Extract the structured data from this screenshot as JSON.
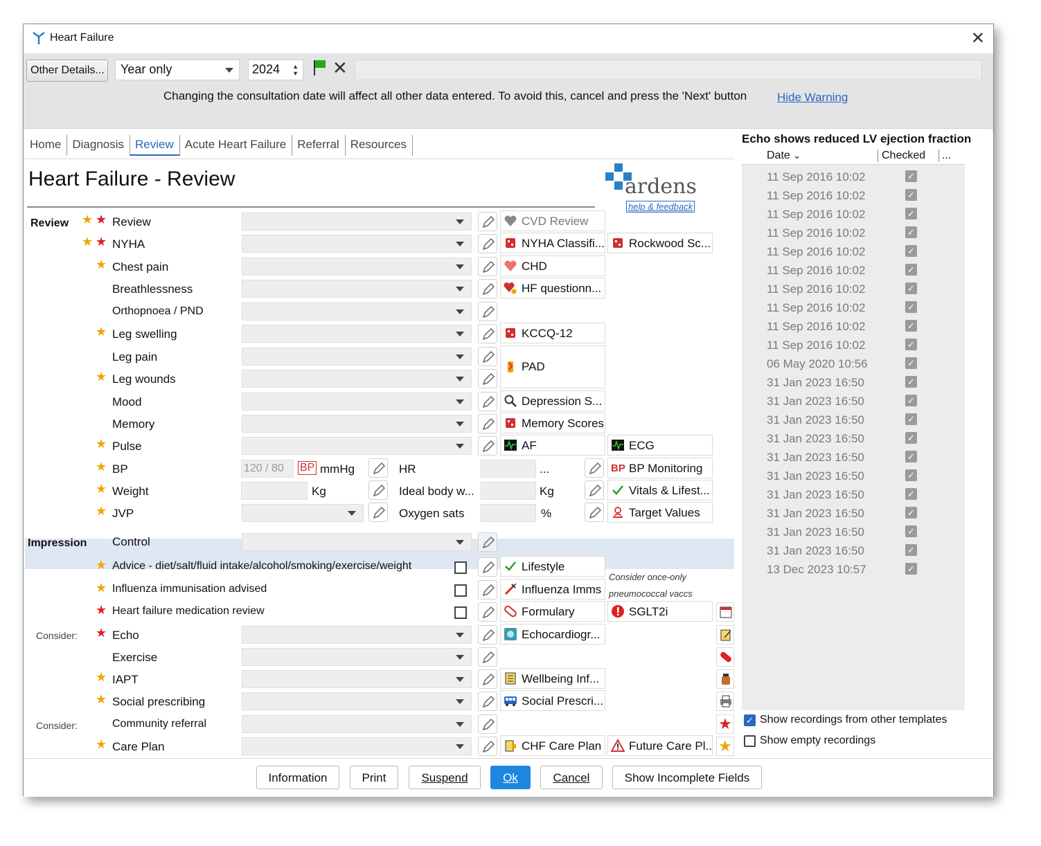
{
  "window": {
    "title": "Heart Failure"
  },
  "toolbar": {
    "other_details": "Other Details...",
    "year_mode": "Year only",
    "year": "2024",
    "warning": "Changing the consultation date will affect all other data entered. To avoid this, cancel and press the 'Next' button",
    "hide_warning": "Hide Warning"
  },
  "tabs": [
    "Home",
    "Diagnosis",
    "Review",
    "Acute Heart Failure",
    "Referral",
    "Resources"
  ],
  "page": {
    "title": "Heart Failure - Review",
    "logo_text": "ardens",
    "help_link": "help & feedback"
  },
  "sections": {
    "review": "Review",
    "impression": "Impression",
    "consider1": "Consider:",
    "consider2": "Consider:"
  },
  "rows": {
    "review": "Review",
    "nyha": "NYHA",
    "chest_pain": "Chest pain",
    "breathlessness": "Breathlessness",
    "orthopnoea": "Orthopnoea / PND",
    "leg_swelling": "Leg swelling",
    "leg_pain": "Leg pain",
    "leg_wounds": "Leg wounds",
    "mood": "Mood",
    "memory": "Memory",
    "pulse": "Pulse",
    "bp": "BP",
    "weight": "Weight",
    "jvp": "JVP",
    "control": "Control",
    "advice": "Advice - diet/salt/fluid intake/alcohol/smoking/exercise/weight",
    "influenza": "Influenza immunisation advised",
    "hf_med_review": "Heart failure medication review",
    "echo": "Echo",
    "exercise": "Exercise",
    "iapt": "IAPT",
    "social_prescribing": "Social prescribing",
    "community_referral": "Community referral",
    "care_plan": "Care Plan"
  },
  "fields": {
    "bp_placeholder": "120 / 80",
    "bp_badge": "BP",
    "mmhg": "mmHg",
    "kg": "Kg",
    "hr": "HR",
    "hr_unit": "...",
    "ideal_weight": "Ideal body w...",
    "ideal_kg": "Kg",
    "oxygen": "Oxygen sats",
    "percent": "%"
  },
  "links": {
    "cvd_review": "CVD Review",
    "nyha_class": "NYHA Classifi...",
    "rockwood": "Rockwood Sc...",
    "chd": "CHD",
    "hf_questionnaire": "HF questionn...",
    "kccq": "KCCQ-12",
    "pad": "PAD",
    "depression": "Depression S...",
    "memory_scores": "Memory Scores",
    "af": "AF",
    "ecg": "ECG",
    "bp_monitoring": "BP Monitoring",
    "vitals": "Vitals & Lifest...",
    "target_values": "Target Values",
    "lifestyle": "Lifestyle",
    "influenza_imms": "Influenza Imms",
    "formulary": "Formulary",
    "sglt2i": "SGLT2i",
    "echocardiogram": "Echocardiogr...",
    "wellbeing": "Wellbeing Inf...",
    "social_prescri": "Social Prescri...",
    "chf_care_plan": "CHF Care Plan",
    "future_care": "Future Care Pl..."
  },
  "notes": {
    "line1": "Consider once-only",
    "line2": "pneumococcal vaccs"
  },
  "panel": {
    "title": "Echo shows reduced LV ejection fraction",
    "col_date": "Date",
    "col_checked": "Checked",
    "col_more": "...",
    "rows": [
      "11 Sep 2016 10:02",
      "11 Sep 2016 10:02",
      "11 Sep 2016 10:02",
      "11 Sep 2016 10:02",
      "11 Sep 2016 10:02",
      "11 Sep 2016 10:02",
      "11 Sep 2016 10:02",
      "11 Sep 2016 10:02",
      "11 Sep 2016 10:02",
      "11 Sep 2016 10:02",
      "06 May 2020 10:56",
      "31 Jan 2023 16:50",
      "31 Jan 2023 16:50",
      "31 Jan 2023 16:50",
      "31 Jan 2023 16:50",
      "31 Jan 2023 16:50",
      "31 Jan 2023 16:50",
      "31 Jan 2023 16:50",
      "31 Jan 2023 16:50",
      "31 Jan 2023 16:50",
      "31 Jan 2023 16:50",
      "13 Dec 2023 10:57"
    ],
    "show_other": "Show recordings from other templates",
    "show_empty": "Show empty recordings"
  },
  "footer": {
    "information": "Information",
    "print": "Print",
    "suspend": "Suspend",
    "ok": "Ok",
    "cancel": "Cancel",
    "show_incomplete": "Show Incomplete Fields"
  },
  "colors": {
    "accent": "#2a66c4",
    "primary_button": "#1f86e0",
    "star_gold": "#f0a500",
    "star_red": "#e02020"
  }
}
